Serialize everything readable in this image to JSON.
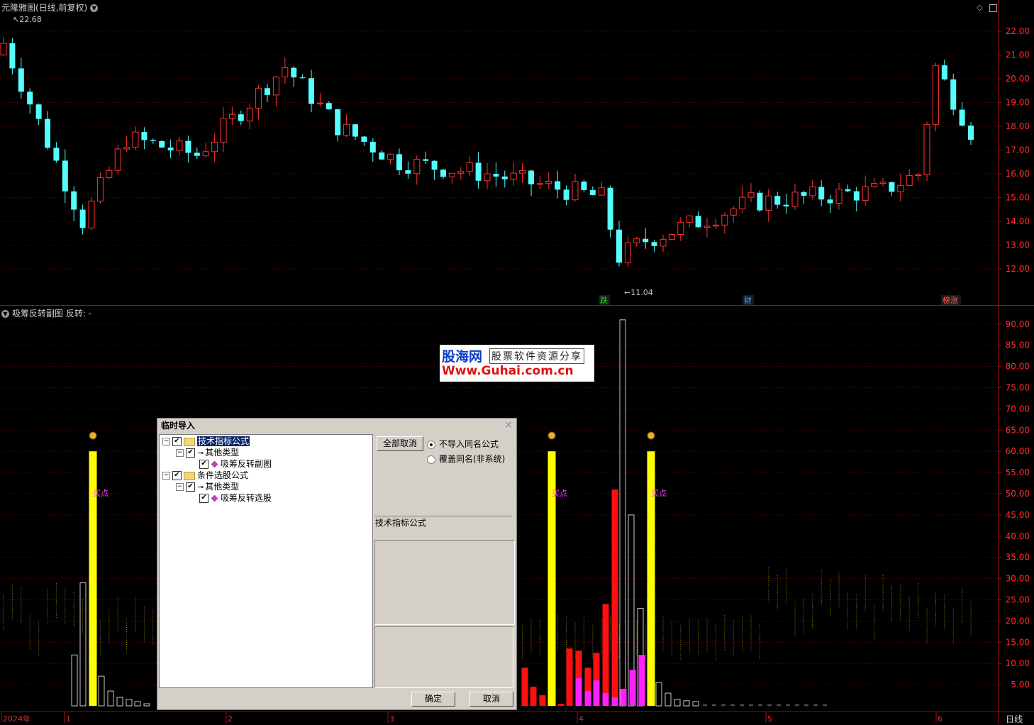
{
  "main_chart": {
    "title": "元隆雅图(日线,前复权)",
    "high_marker": "22.68",
    "low_marker": "11.04",
    "price_scale": [
      "22.00",
      "21.00",
      "20.00",
      "19.00",
      "18.00",
      "17.00",
      "16.00",
      "15.00",
      "14.00",
      "13.00",
      "12.00"
    ],
    "events": [
      {
        "label": "跌",
        "color": "#33cc33"
      },
      {
        "label": "财",
        "color": "#4aa8ff"
      },
      {
        "label": "榜涨",
        "color": "#ff6060"
      }
    ],
    "colors": {
      "up": "#ff3232",
      "down": "#54ffff",
      "grid": "#7a0000",
      "axis": "#a01010"
    }
  },
  "sub_chart": {
    "title": "吸筹反转副图  反转: -",
    "scale": [
      "90.00",
      "85.00",
      "80.00",
      "75.00",
      "70.00",
      "65.00",
      "60.00",
      "55.00",
      "50.00",
      "45.00",
      "40.00",
      "35.00",
      "30.00",
      "25.00",
      "20.00",
      "15.00",
      "10.00",
      "5.00"
    ],
    "buy_label": "买点",
    "colors": {
      "signal": "#ffff00",
      "red": "#ff1010",
      "magenta": "#ff20ff",
      "outline": "#c8c8c8"
    }
  },
  "x_axis": {
    "labels": [
      "2024年",
      "1",
      "2",
      "3",
      "4",
      "5",
      "6"
    ],
    "period": "日线"
  },
  "watermark": {
    "name": "股海网",
    "slogan": "股票软件资源分享",
    "url": "Www.Guhai.com.cn"
  },
  "dialog": {
    "title": "临时导入",
    "close": "×",
    "tree": [
      {
        "label": "技术指标公式",
        "level": 0,
        "checked": true,
        "type": "folder",
        "selected": true
      },
      {
        "label": "其他类型",
        "level": 1,
        "checked": true,
        "type": "key"
      },
      {
        "label": "吸筹反转副图",
        "level": 2,
        "checked": true,
        "type": "formula"
      },
      {
        "label": "条件选股公式",
        "level": 0,
        "checked": true,
        "type": "folder"
      },
      {
        "label": "其他类型",
        "level": 1,
        "checked": true,
        "type": "key"
      },
      {
        "label": "吸筹反转选股",
        "level": 2,
        "checked": true,
        "type": "formula"
      }
    ],
    "cancel_all": "全部取消",
    "radio_no_import": "不导入同名公式",
    "radio_overwrite": "覆盖同名(非系统)",
    "radio_selected": 0,
    "info_label": "技术指标公式",
    "ok": "确定",
    "cancel": "取消"
  }
}
